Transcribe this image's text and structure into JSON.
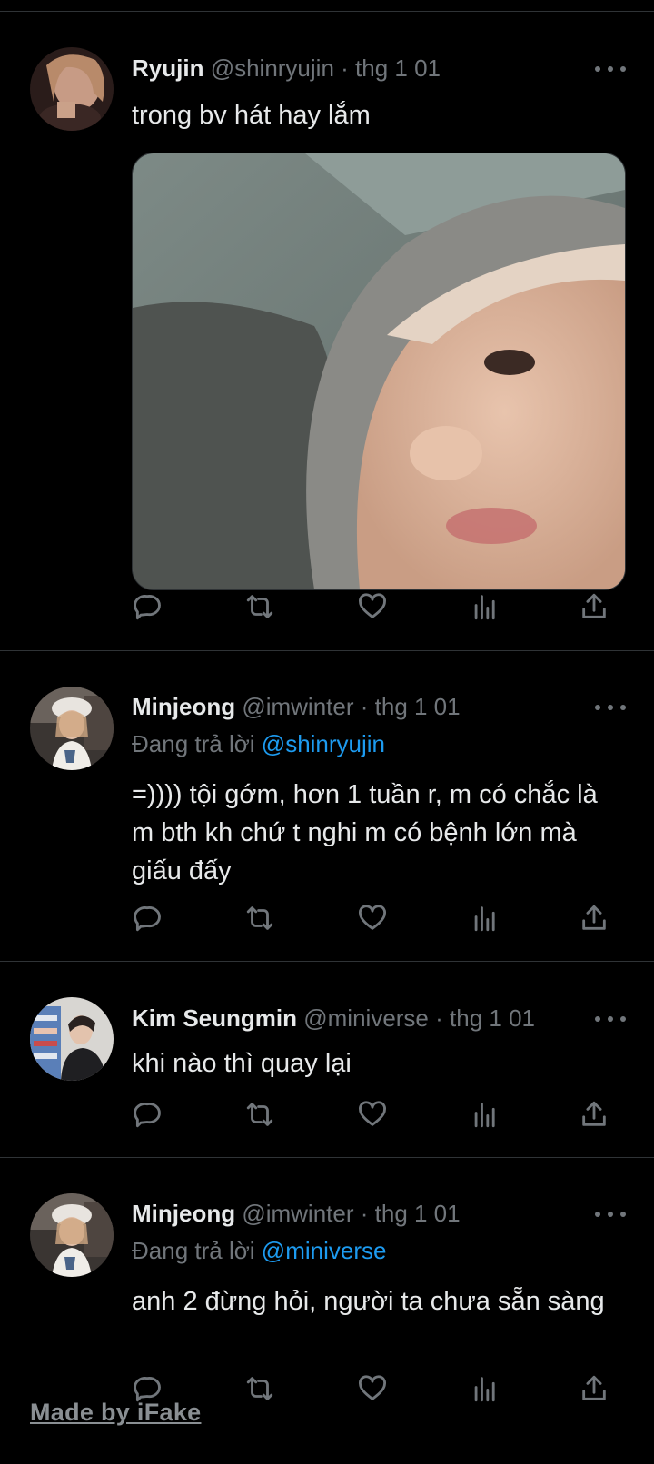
{
  "tweets": [
    {
      "name": "Ryujin",
      "handle": "@shinryujin",
      "date": "· thg 1 01",
      "text": "trong bv hát hay lắm",
      "has_media": true
    },
    {
      "name": "Minjeong",
      "handle": "@imwinter",
      "date": "· thg 1 01",
      "reply_prefix": "Đang trả lời",
      "reply_to": "@shinryujin",
      "text": "=)))) tội gớm, hơn 1 tuần r, m có chắc là m bth kh chứ t nghi m có bệnh lớn mà giấu đấy"
    },
    {
      "name": "Kim Seungmin",
      "handle": "@miniverse",
      "date": "· thg 1 01",
      "text": "khi nào thì quay lại"
    },
    {
      "name": "Minjeong",
      "handle": "@imwinter",
      "date": "· thg 1 01",
      "reply_prefix": "Đang trả lời",
      "reply_to": "@miniverse",
      "text": "anh 2 đừng hỏi, người ta chưa sẵn sàng"
    }
  ],
  "icons": [
    "reply-icon",
    "retweet-icon",
    "like-icon",
    "views-icon",
    "share-icon",
    "more-icon"
  ],
  "watermark": "Made by iFake",
  "colors": {
    "background": "#000000",
    "text": "#e7e9ea",
    "muted": "#71767b",
    "link": "#1d9bf0",
    "divider": "#2f3336"
  }
}
